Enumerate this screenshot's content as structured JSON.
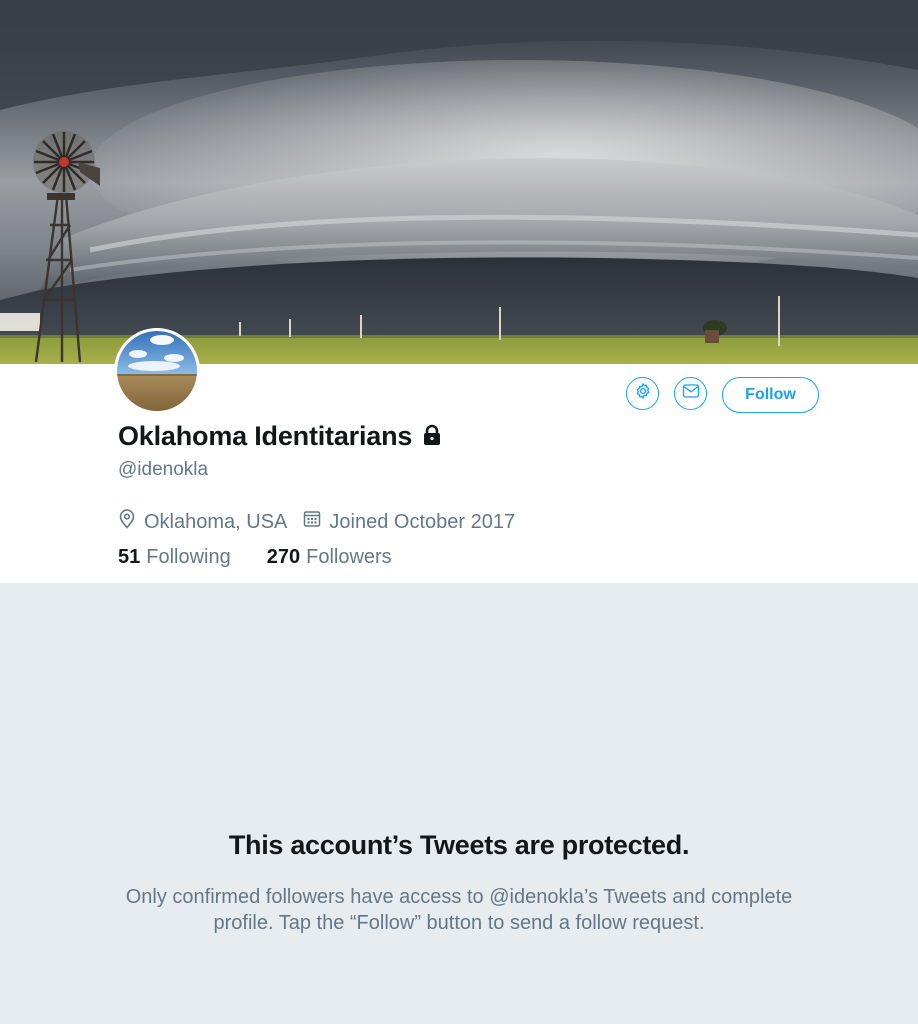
{
  "profile": {
    "display_name": "Oklahoma Identitarians",
    "handle": "@idenokla",
    "location": "Oklahoma, USA",
    "joined": "Joined October 2017",
    "following_count": "51",
    "following_label": "Following",
    "followers_count": "270",
    "followers_label": "Followers",
    "protected": true
  },
  "actions": {
    "follow_label": "Follow",
    "settings_icon": "gear-icon",
    "message_icon": "envelope-icon"
  },
  "notice": {
    "title": "This account’s Tweets are protected.",
    "body": "Only confirmed followers have access to @idenokla’s Tweets and complete profile. Tap the “Follow” button to send a follow request."
  },
  "colors": {
    "accent": "#1da1f2",
    "text_primary": "#14171a",
    "text_secondary": "#657786",
    "background": "#e6ecf0"
  }
}
